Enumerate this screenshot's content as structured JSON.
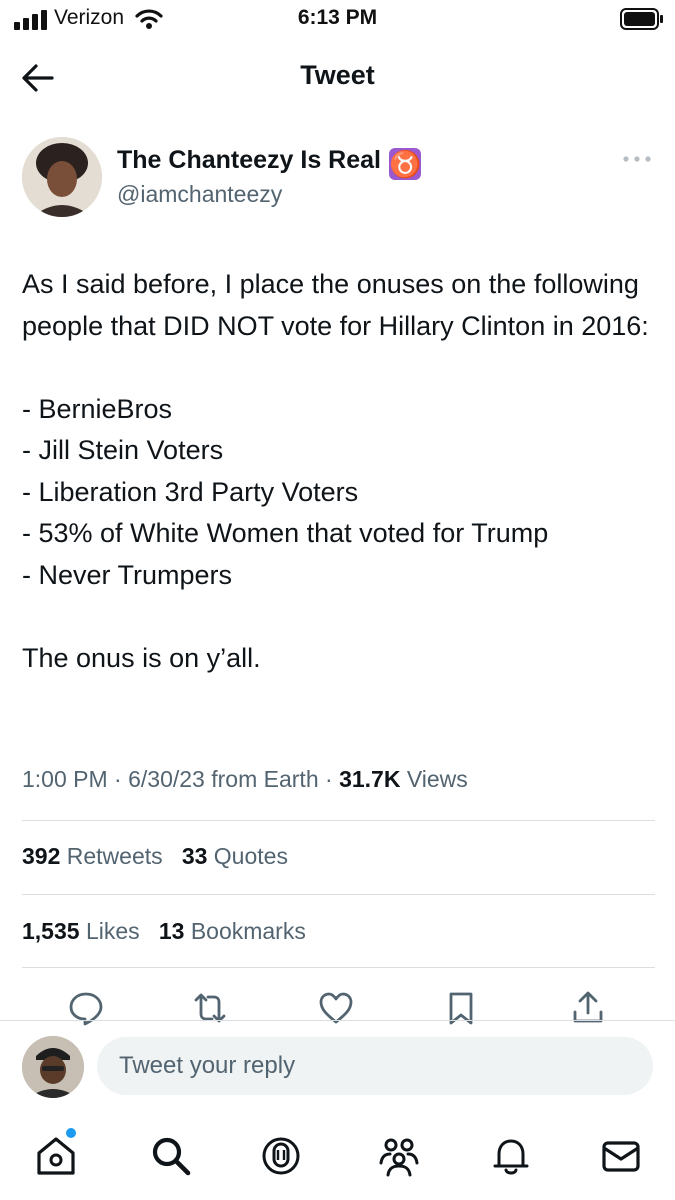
{
  "status_bar": {
    "carrier": "Verizon",
    "time": "6:13 PM"
  },
  "header": {
    "title": "Tweet"
  },
  "author": {
    "name": "The Chanteezy Is Real",
    "zodiac": "♉",
    "handle": "@iamchanteezy"
  },
  "tweet": {
    "text": "As I said before, I place the onuses on the following people that DID NOT vote for Hillary Clinton in 2016:\n\n- BernieBros\n- Jill Stein Voters\n- Liberation 3rd Party Voters\n- 53% of White Women that voted for Trump\n- Never Trumpers\n\nThe onus is on y’all.",
    "time": "1:00 PM",
    "date": "6/30/23",
    "source": "from Earth",
    "views_count": "31.7K",
    "views_label": "Views"
  },
  "stats": {
    "retweets_count": "392",
    "retweets_label": "Retweets",
    "quotes_count": "33",
    "quotes_label": "Quotes",
    "likes_count": "1,535",
    "likes_label": "Likes",
    "bookmarks_count": "13",
    "bookmarks_label": "Bookmarks"
  },
  "actions": [
    "reply-icon",
    "retweet-icon",
    "like-icon",
    "bookmark-icon",
    "share-icon"
  ],
  "reply": {
    "placeholder": "Tweet your reply"
  },
  "tab_bar": [
    "home-icon",
    "search-icon",
    "spaces-icon",
    "communities-icon",
    "notifications-icon",
    "messages-icon"
  ],
  "colors": {
    "text": "#0f1419",
    "secondary": "#536471",
    "accent": "#1d9bf0",
    "zodiac_bg": "#9b59d0"
  }
}
